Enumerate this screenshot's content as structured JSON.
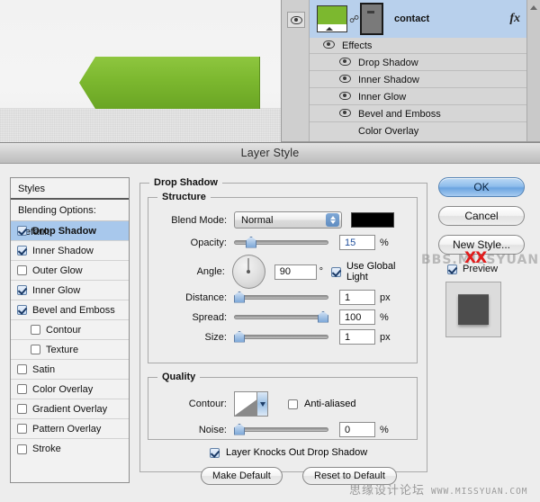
{
  "canvas": {
    "shape_name": "green-arrow-banner",
    "shape_color": "#7cb82f"
  },
  "layers_panel": {
    "layer": {
      "name": "contact",
      "fx_badge": "fx",
      "visible_icon": "eye-icon",
      "link_icon": "link-icon"
    },
    "effects_header": "Effects",
    "effects": [
      {
        "label": "Drop Shadow"
      },
      {
        "label": "Inner Shadow"
      },
      {
        "label": "Inner Glow"
      },
      {
        "label": "Bevel and Emboss"
      },
      {
        "label": "Color Overlay"
      }
    ]
  },
  "dialog": {
    "title": "Layer Style"
  },
  "styles": {
    "header": "Styles",
    "blending_options": "Blending Options: Default",
    "items": [
      {
        "label": "Drop Shadow",
        "checked": true,
        "selected": true,
        "indent": false
      },
      {
        "label": "Inner Shadow",
        "checked": true,
        "selected": false,
        "indent": false
      },
      {
        "label": "Outer Glow",
        "checked": false,
        "selected": false,
        "indent": false
      },
      {
        "label": "Inner Glow",
        "checked": true,
        "selected": false,
        "indent": false
      },
      {
        "label": "Bevel and Emboss",
        "checked": true,
        "selected": false,
        "indent": false
      },
      {
        "label": "Contour",
        "checked": false,
        "selected": false,
        "indent": true
      },
      {
        "label": "Texture",
        "checked": false,
        "selected": false,
        "indent": true
      },
      {
        "label": "Satin",
        "checked": false,
        "selected": false,
        "indent": false
      },
      {
        "label": "Color Overlay",
        "checked": false,
        "selected": false,
        "indent": false
      },
      {
        "label": "Gradient Overlay",
        "checked": false,
        "selected": false,
        "indent": false
      },
      {
        "label": "Pattern Overlay",
        "checked": false,
        "selected": false,
        "indent": false
      },
      {
        "label": "Stroke",
        "checked": false,
        "selected": false,
        "indent": false
      }
    ]
  },
  "drop_shadow": {
    "group_title": "Drop Shadow",
    "structure": {
      "title": "Structure",
      "blend_mode_label": "Blend Mode:",
      "blend_mode_value": "Normal",
      "shadow_color": "#000000",
      "opacity_label": "Opacity:",
      "opacity_value": "15",
      "opacity_unit": "%",
      "opacity_pct": 15,
      "angle_label": "Angle:",
      "angle_value": "90",
      "angle_unit": "°",
      "use_global_light_label": "Use Global Light",
      "use_global_light_checked": true,
      "distance_label": "Distance:",
      "distance_value": "1",
      "distance_unit": "px",
      "distance_pct": 1,
      "spread_label": "Spread:",
      "spread_value": "100",
      "spread_unit": "%",
      "spread_pct": 100,
      "size_label": "Size:",
      "size_value": "1",
      "size_unit": "px",
      "size_pct": 1
    },
    "quality": {
      "title": "Quality",
      "contour_label": "Contour:",
      "anti_aliased_label": "Anti-aliased",
      "anti_aliased_checked": false,
      "noise_label": "Noise:",
      "noise_value": "0",
      "noise_unit": "%",
      "noise_pct": 0
    },
    "knockout_label": "Layer Knocks Out Drop Shadow",
    "knockout_checked": true,
    "make_default_label": "Make Default",
    "reset_default_label": "Reset to Default"
  },
  "buttons": {
    "ok": "OK",
    "cancel": "Cancel",
    "new_style": "New Style...",
    "preview_label": "Preview",
    "preview_checked": true
  },
  "watermarks": {
    "right_text": "BBS.MISSYUAN.COM",
    "right_mark": "XX",
    "bottom_cn": "思缘设计论坛",
    "bottom_en": "WWW.MISSYUAN.COM"
  }
}
